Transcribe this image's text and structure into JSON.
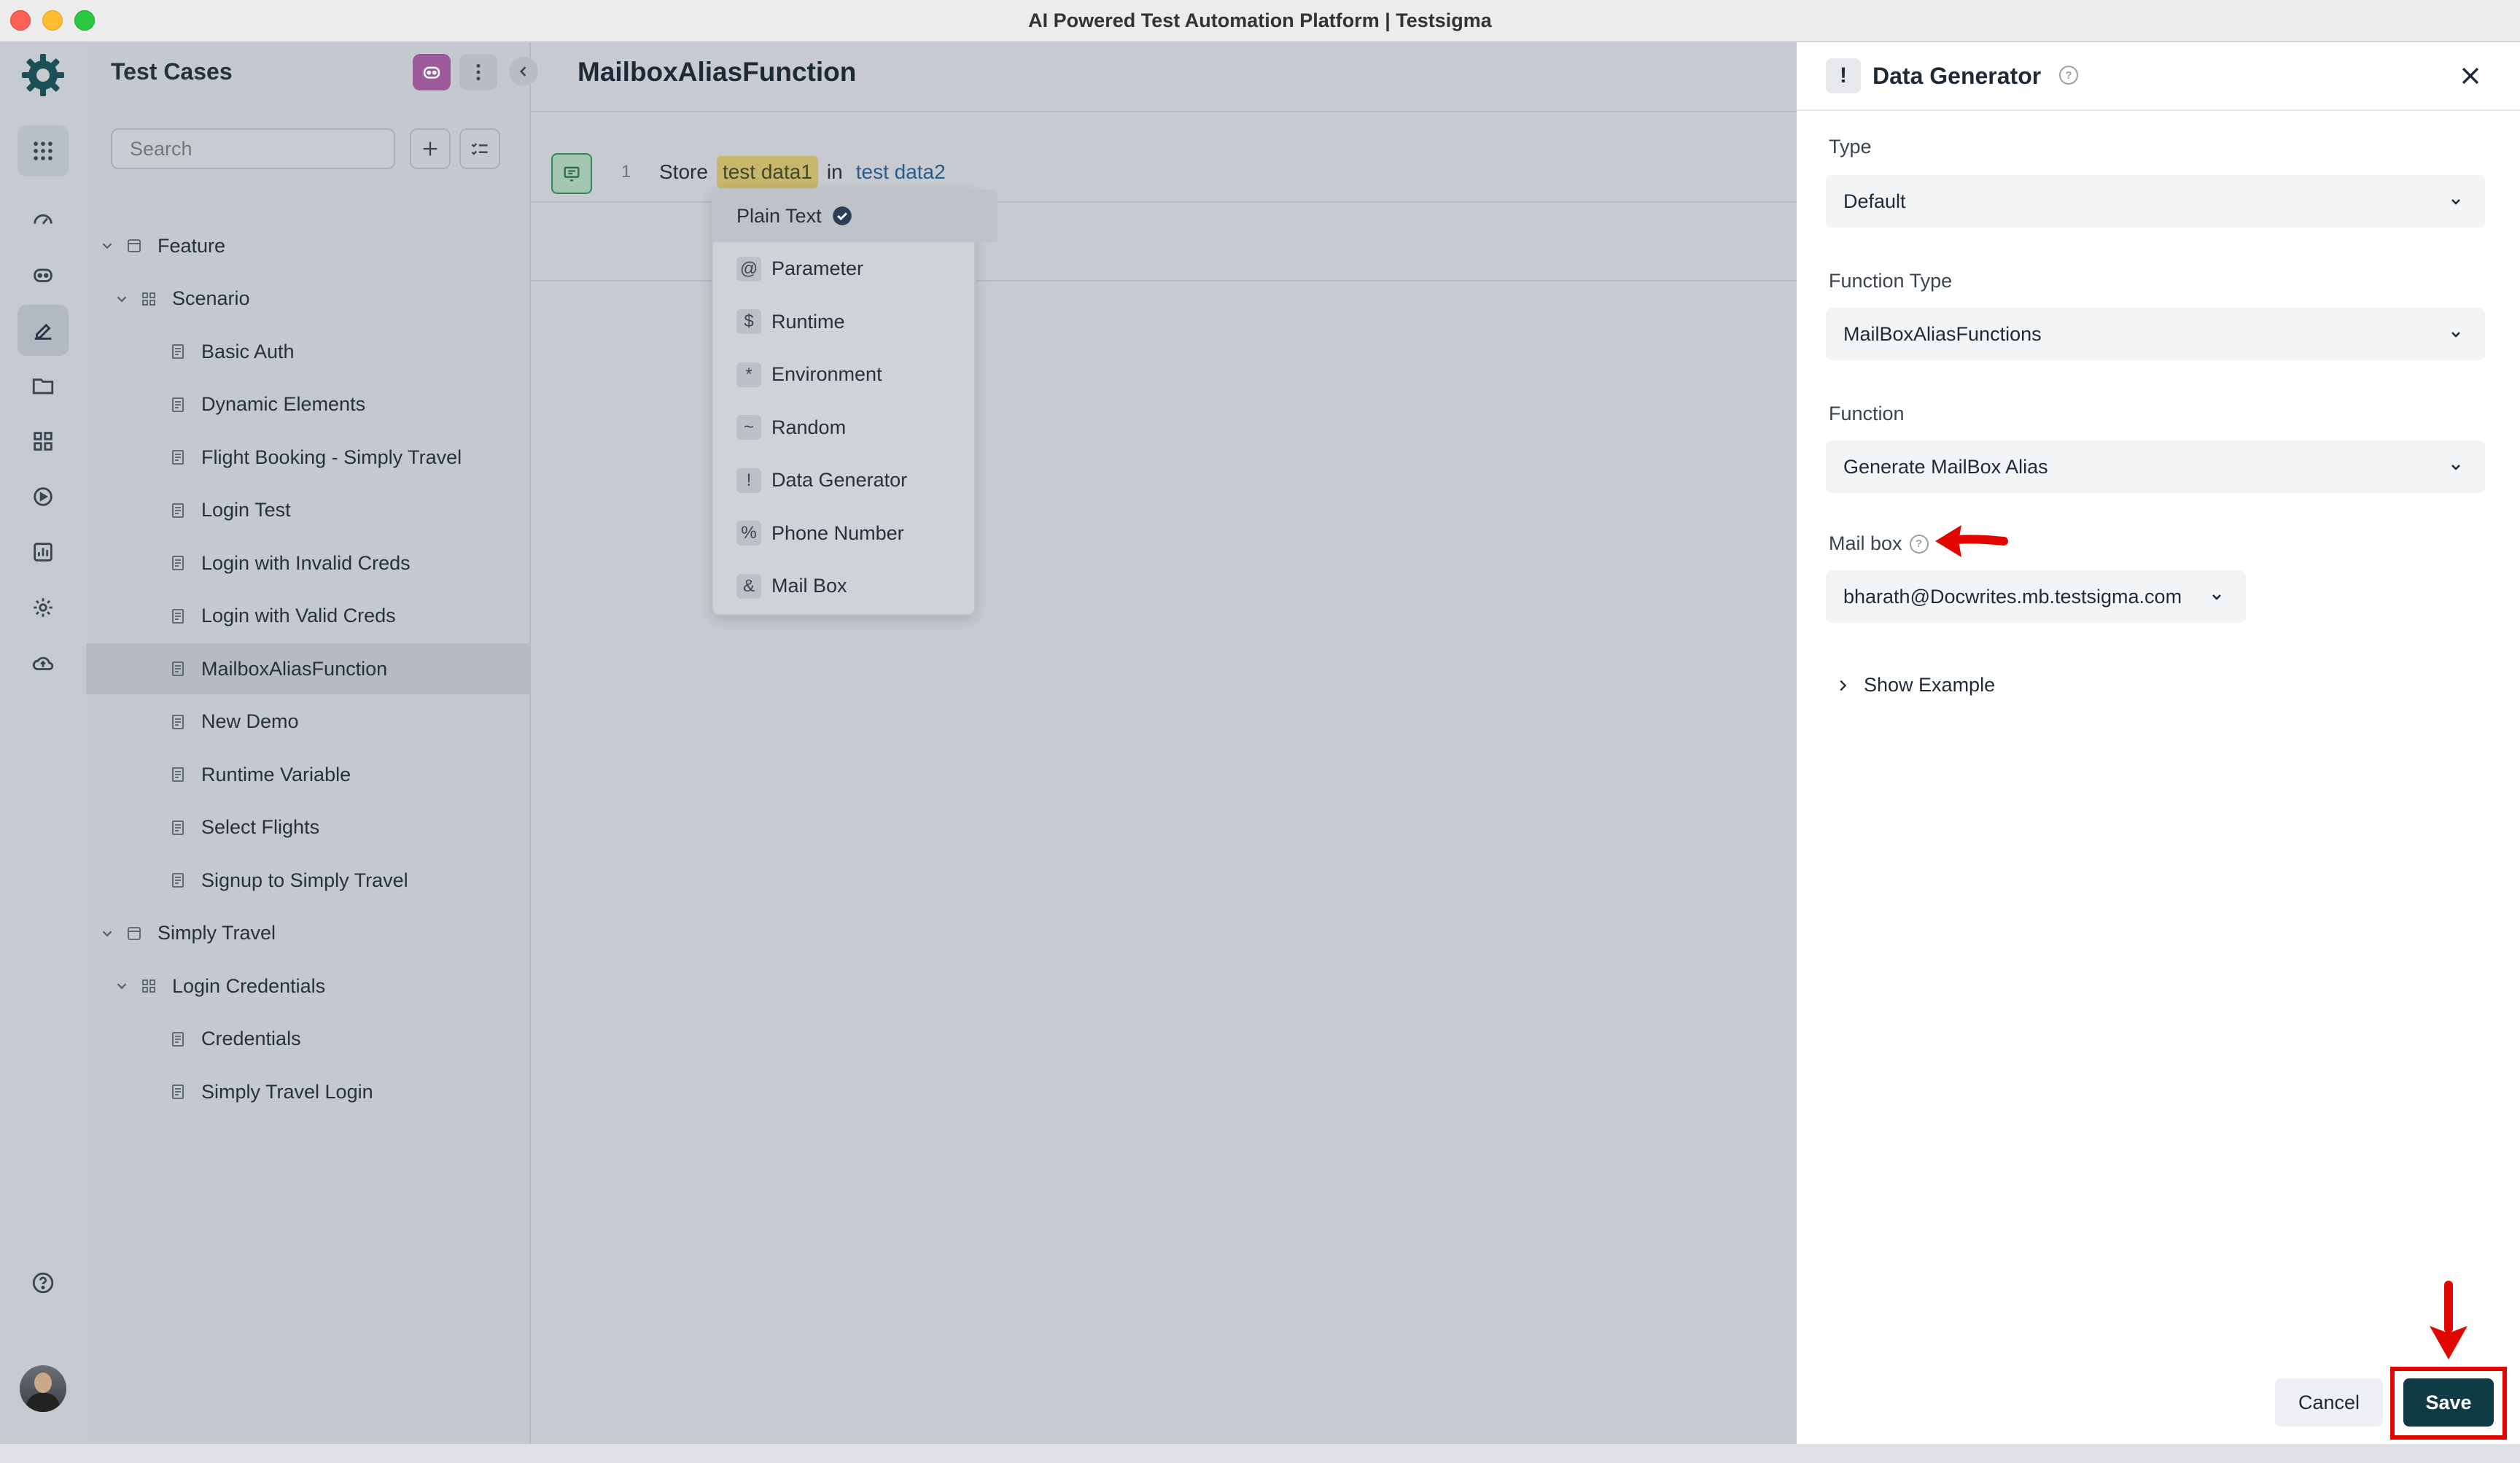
{
  "window": {
    "title": "AI Powered Test Automation Platform | Testsigma"
  },
  "nav_rail": {
    "items": [
      "dashboard-icon",
      "robot-icon",
      "edit-icon",
      "folder-icon",
      "grid-icon",
      "play-icon",
      "chart-icon",
      "gear-icon",
      "cloud-icon"
    ],
    "help": "help-icon"
  },
  "test_cases": {
    "title": "Test Cases",
    "search_placeholder": "Search",
    "tree": [
      {
        "label": "Feature",
        "level": 0,
        "kind": "folder",
        "expanded": true
      },
      {
        "label": "Scenario",
        "level": 1,
        "kind": "group",
        "expanded": true
      },
      {
        "label": "Basic Auth",
        "level": 2,
        "kind": "case"
      },
      {
        "label": "Dynamic Elements",
        "level": 2,
        "kind": "case"
      },
      {
        "label": "Flight Booking - Simply Travel",
        "level": 2,
        "kind": "case"
      },
      {
        "label": "Login Test",
        "level": 2,
        "kind": "case"
      },
      {
        "label": "Login with Invalid Creds",
        "level": 2,
        "kind": "case"
      },
      {
        "label": "Login with Valid Creds",
        "level": 2,
        "kind": "case"
      },
      {
        "label": "MailboxAliasFunction",
        "level": 2,
        "kind": "case",
        "selected": true
      },
      {
        "label": "New Demo",
        "level": 2,
        "kind": "case"
      },
      {
        "label": "Runtime Variable",
        "level": 2,
        "kind": "case"
      },
      {
        "label": "Select Flights",
        "level": 2,
        "kind": "case"
      },
      {
        "label": "Signup to Simply Travel",
        "level": 2,
        "kind": "case"
      },
      {
        "label": "Simply Travel",
        "level": 0,
        "kind": "folder",
        "expanded": true
      },
      {
        "label": "Login Credentials",
        "level": 1,
        "kind": "group",
        "expanded": true
      },
      {
        "label": "Credentials",
        "level": 2,
        "kind": "case"
      },
      {
        "label": "Simply Travel Login",
        "level": 2,
        "kind": "case"
      }
    ]
  },
  "editor": {
    "title": "MailboxAliasFunction",
    "step": {
      "number": "1",
      "action": "Store",
      "value1": "test data1",
      "connector": "in",
      "value2": "test data2"
    },
    "data_type_menu": [
      {
        "symbol": "",
        "label": "Plain Text",
        "selected": true
      },
      {
        "symbol": "@",
        "label": "Parameter"
      },
      {
        "symbol": "$",
        "label": "Runtime"
      },
      {
        "symbol": "*",
        "label": "Environment"
      },
      {
        "symbol": "~",
        "label": "Random"
      },
      {
        "symbol": "!",
        "label": "Data Generator"
      },
      {
        "symbol": "%",
        "label": "Phone Number"
      },
      {
        "symbol": "&",
        "label": "Mail Box"
      }
    ]
  },
  "drawer": {
    "icon_symbol": "!",
    "title": "Data Generator",
    "type_label": "Type",
    "type_value": "Default",
    "function_type_label": "Function Type",
    "function_type_value": "MailBoxAliasFunctions",
    "function_label": "Function",
    "function_value": "Generate MailBox Alias",
    "mailbox_label": "Mail box",
    "mailbox_value": "bharath@Docwrites.mb.testsigma.com",
    "show_example": "Show Example",
    "cancel_label": "Cancel",
    "save_label": "Save"
  },
  "colors": {
    "accent": "#0e3b44",
    "annotation": "#e10600",
    "highlight_chip": "#c8b66a"
  }
}
